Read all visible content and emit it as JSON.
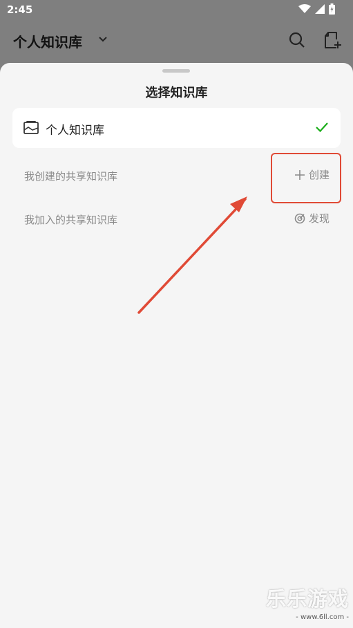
{
  "status_bar": {
    "time": "2:45"
  },
  "header": {
    "title": "个人知识库"
  },
  "sheet": {
    "title": "选择知识库",
    "selected_kb": {
      "label": "个人知识库",
      "selected": true
    },
    "sections": [
      {
        "label": "我创建的共享知识库",
        "action_label": "创建",
        "action_icon": "plus-icon"
      },
      {
        "label": "我加入的共享知识库",
        "action_label": "发现",
        "action_icon": "discover-icon"
      }
    ]
  },
  "annotation": {
    "highlight_color": "#e04a36"
  },
  "colors": {
    "check": "#1aad19",
    "muted_text": "#8a8a8a"
  },
  "watermark": {
    "main": "乐乐游戏",
    "sub": "- www.6ll.com -"
  }
}
